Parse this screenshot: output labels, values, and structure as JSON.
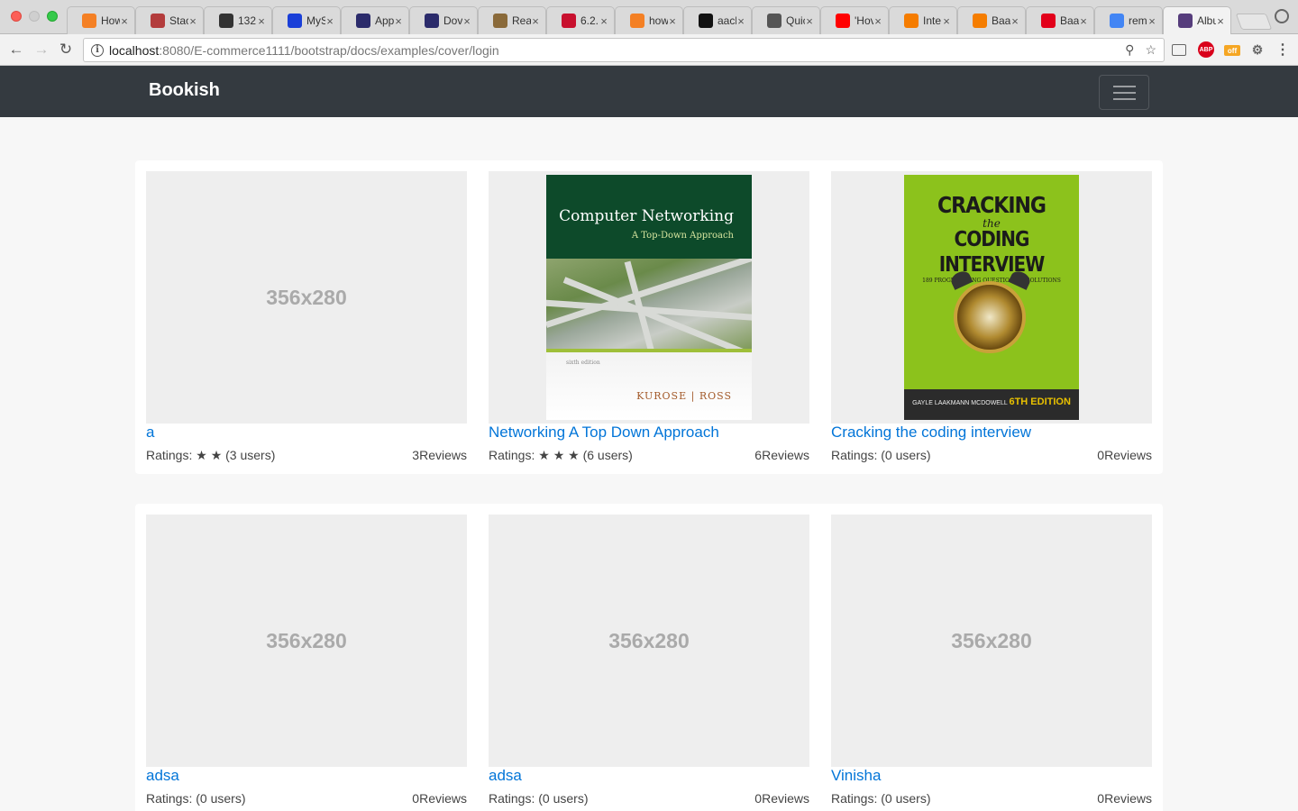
{
  "browser": {
    "tabs": [
      {
        "title": "How",
        "icon": "stackoverflow-icon",
        "color": "#f48024"
      },
      {
        "title": "Stac",
        "icon": "stackexchange-icon",
        "color": "#b33c3c"
      },
      {
        "title": "132",
        "icon": "github-gear-icon",
        "color": "#333333"
      },
      {
        "title": "MyS",
        "icon": "typora-icon",
        "color": "#1a3fd8"
      },
      {
        "title": "App",
        "icon": "eye-icon",
        "color": "#2b2b6b"
      },
      {
        "title": "Dov",
        "icon": "eye-icon",
        "color": "#2b2b6b"
      },
      {
        "title": "Rea",
        "icon": "avatar-icon",
        "color": "#8a6a3a"
      },
      {
        "title": "6.2.",
        "icon": "dr-icon",
        "color": "#c8102e"
      },
      {
        "title": "how",
        "icon": "stackoverflow-icon",
        "color": "#f48024"
      },
      {
        "title": "aacl",
        "icon": "github-icon",
        "color": "#111111"
      },
      {
        "title": "Quic",
        "icon": "document-icon",
        "color": "#555555"
      },
      {
        "title": "'Hov",
        "icon": "youtube-icon",
        "color": "#ff0000"
      },
      {
        "title": "Inte",
        "icon": "flame-icon",
        "color": "#f57c00"
      },
      {
        "title": "Baa",
        "icon": "blogger-icon",
        "color": "#f57d00"
      },
      {
        "title": "Baa",
        "icon": "dealer-icon",
        "color": "#e2001a"
      },
      {
        "title": "rem",
        "icon": "google-icon",
        "color": "#4285f4"
      },
      {
        "title": "Albu",
        "icon": "bootstrap-icon",
        "color": "#563d7c"
      }
    ],
    "url_host": "localhost",
    "url_path": ":8080/E-commerce1111/bootstrap/docs/examples/cover/login",
    "extensions": {
      "abp": "ABP",
      "off": "off"
    }
  },
  "navbar": {
    "brand": "Bookish"
  },
  "cards": [
    {
      "title": "a",
      "ratings": "Ratings: ★ ★ (3 users)",
      "reviews": "3Reviews",
      "placeholder": "356x280"
    },
    {
      "title": "Networking A Top Down Approach",
      "ratings": "Ratings: ★ ★ ★ (6 users)",
      "reviews": "6Reviews",
      "cover": {
        "title": "Computer Networking",
        "subtitle": "A Top-Down Approach",
        "edition": "sixth edition",
        "authors": "KUROSE | ROSS"
      }
    },
    {
      "title": "Cracking the coding interview",
      "ratings": "Ratings: (0 users)",
      "reviews": "0Reviews",
      "cover": {
        "line1": "CRACKING",
        "line2": "the",
        "line3": "CODING INTERVIEW",
        "tagline": "189 PROGRAMMING QUESTIONS & SOLUTIONS",
        "author": "GAYLE LAAKMANN MCDOWELL",
        "edition": "6TH EDITION"
      }
    },
    {
      "title": "adsa",
      "ratings": "Ratings: (0 users)",
      "reviews": "0Reviews",
      "placeholder": "356x280"
    },
    {
      "title": "adsa",
      "ratings": "Ratings: (0 users)",
      "reviews": "0Reviews",
      "placeholder": "356x280"
    },
    {
      "title": "Vinisha",
      "ratings": "Ratings: (0 users)",
      "reviews": "0Reviews",
      "placeholder": "356x280"
    }
  ],
  "colors": {
    "navbar": "#343a40",
    "link": "#0275d8",
    "placeholder_bg": "#eeeeee"
  }
}
